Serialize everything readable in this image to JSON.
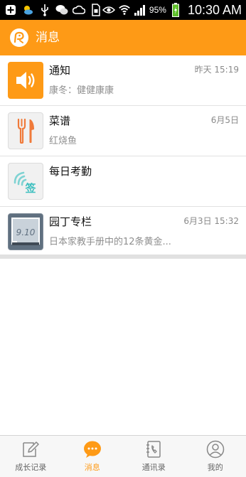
{
  "status_bar": {
    "battery": "95%",
    "time": "10:30 AM",
    "left_icons": [
      "plus-icon",
      "weather-icon",
      "usb-icon",
      "wechat-icon",
      "cloud-icon",
      "sim-icon"
    ],
    "right_icons": [
      "eye-icon",
      "wifi-icon",
      "signal-icon",
      "battery-icon"
    ]
  },
  "header": {
    "title": "消息",
    "logo_icon": "app-logo-icon"
  },
  "messages": [
    {
      "title": "通知",
      "time": "昨天 15:19",
      "preview": "康冬：健健康康",
      "icon": "speaker-icon"
    },
    {
      "title": "菜谱",
      "time": "6月5日",
      "preview": "红烧鱼",
      "icon": "fork-knife-icon"
    },
    {
      "title": "每日考勤",
      "time": "",
      "preview": "",
      "icon": "checkin-icon",
      "icon_text": "签"
    },
    {
      "title": "园丁专栏",
      "time": "6月3日 15:32",
      "preview": "日本家教手册中的12条黄金...",
      "icon": "blackboard-icon",
      "icon_text": "9.10"
    }
  ],
  "bottom_nav": [
    {
      "label": "成长记录",
      "icon": "edit-icon",
      "active": false
    },
    {
      "label": "消息",
      "icon": "chat-icon",
      "active": true
    },
    {
      "label": "通讯录",
      "icon": "phonebook-icon",
      "active": false
    },
    {
      "label": "我的",
      "icon": "profile-icon",
      "active": false
    }
  ],
  "colors": {
    "accent": "#fe9a16",
    "status_bar": "#000000",
    "text_primary": "#111111",
    "text_secondary": "#8f8f8f",
    "checkin_teal": "#3dbfbf"
  }
}
